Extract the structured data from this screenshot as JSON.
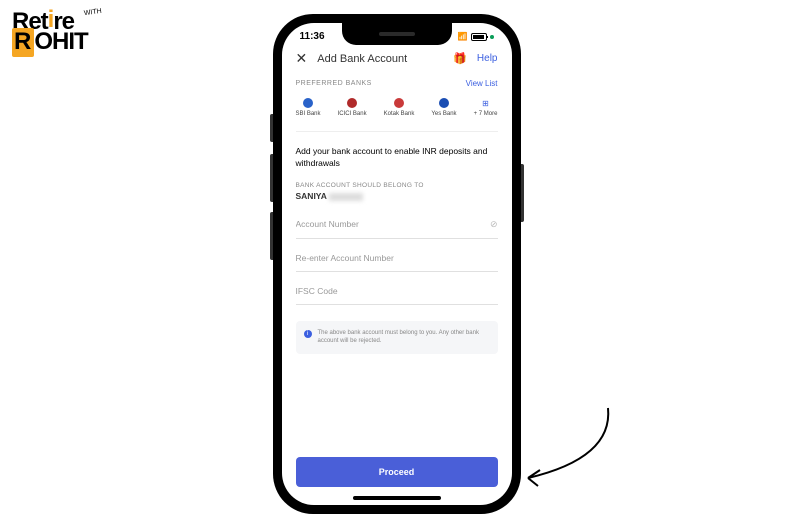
{
  "logo": {
    "line1": "Retire",
    "line2_highlight": "R",
    "line2_rest": "OHIT",
    "with": "WITH"
  },
  "status": {
    "time": "11:36",
    "battery": "82"
  },
  "header": {
    "title": "Add Bank Account",
    "help": "Help"
  },
  "pref": {
    "label": "PREFERRED BANKS",
    "view": "View List"
  },
  "banks": [
    {
      "name": "SBI Bank",
      "color": "#2962c9"
    },
    {
      "name": "ICICI Bank",
      "color": "#b02a2a"
    },
    {
      "name": "Kotak Bank",
      "color": "#c93a3a"
    },
    {
      "name": "Yes Bank",
      "color": "#1a4db3"
    }
  ],
  "more": "+ 7 More",
  "desc": "Add your bank account to enable INR deposits and withdrawals",
  "belong_label": "BANK ACCOUNT SHOULD BELONG TO",
  "name": "SANIYA",
  "fields": {
    "account": "Account Number",
    "reenter": "Re-enter Account Number",
    "ifsc": "IFSC Code"
  },
  "note": "The above bank account must belong to you. Any other bank account will be rejected.",
  "proceed": "Proceed"
}
